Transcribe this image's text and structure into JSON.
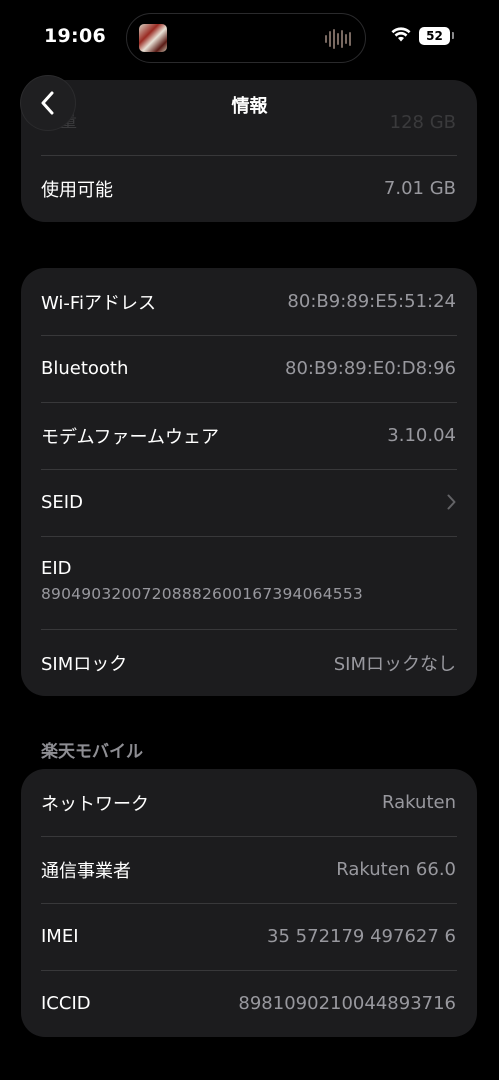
{
  "status_bar": {
    "time": "19:06",
    "battery": "52"
  },
  "nav": {
    "title": "情報",
    "back_icon": "chevron-left-icon"
  },
  "storage_card": {
    "capacity_label": "容量",
    "capacity_value": "128 GB",
    "available_label": "使用可能",
    "available_value": "7.01 GB"
  },
  "network_card": {
    "rows": [
      {
        "label": "Wi-Fiアドレス",
        "value": "80:B9:89:E5:51:24"
      },
      {
        "label": "Bluetooth",
        "value": "80:B9:89:E0:D8:96"
      },
      {
        "label": "モデムファームウェア",
        "value": "3.10.04"
      }
    ],
    "seid_label": "SEID",
    "eid_label": "EID",
    "eid_value": "89049032007208882600167394064553",
    "sim_lock_label": "SIMロック",
    "sim_lock_value": "SIMロックなし"
  },
  "carrier_section": {
    "header": "楽天モバイル",
    "rows": [
      {
        "label": "ネットワーク",
        "value": "Rakuten"
      },
      {
        "label": "通信事業者",
        "value": "Rakuten 66.0"
      },
      {
        "label": "IMEI",
        "value": "35 572179 497627 6"
      },
      {
        "label": "ICCID",
        "value": "8981090210044893716"
      }
    ]
  },
  "colors": {
    "background": "#000000",
    "card": "#1c1c1e",
    "secondary_text": "#98989e",
    "separator": "#38383a"
  }
}
